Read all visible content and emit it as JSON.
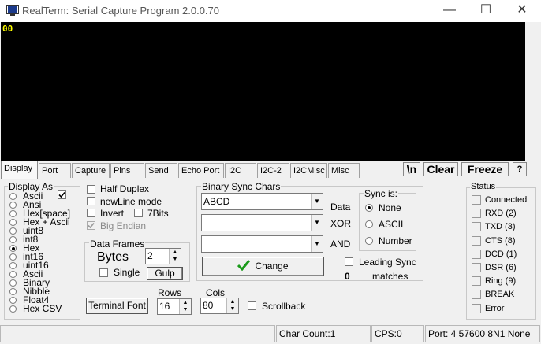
{
  "window": {
    "title": "RealTerm: Serial Capture Program 2.0.0.70",
    "minimize": "—",
    "maximize": "☐",
    "close": "✕"
  },
  "terminal": {
    "text": "00"
  },
  "tabs": [
    "Display",
    "Port",
    "Capture",
    "Pins",
    "Send",
    "Echo Port",
    "I2C",
    "I2C-2",
    "I2CMisc",
    "Misc"
  ],
  "top_buttons": {
    "newline": "\\n",
    "clear": "Clear",
    "freeze": "Freeze",
    "help": "?"
  },
  "display_as": {
    "title": "Display As",
    "options": [
      "Ascii",
      "Ansi",
      "Hex[space]",
      "Hex + Ascii",
      "uint8",
      "int8",
      "Hex",
      "int16",
      "uint16",
      "Ascii",
      "Binary",
      "Nibble",
      "Float4",
      "Hex CSV"
    ],
    "selected": "Hex"
  },
  "options": {
    "half_duplex": "Half Duplex",
    "newline_mode": "newLine mode",
    "invert": "Invert",
    "seven_bits": "7Bits",
    "big_endian": "Big Endian"
  },
  "data_frames": {
    "title": "Data Frames",
    "bytes_label": "Bytes",
    "bytes_value": "2",
    "single": "Single",
    "gulp": "Gulp"
  },
  "binary_sync": {
    "title": "Binary Sync Chars",
    "data_value": "ABCD",
    "data_label": "Data",
    "xor_label": "XOR",
    "and_label": "AND",
    "change": "Change",
    "sync_is_title": "Sync is:",
    "sync_options": [
      "None",
      "ASCII",
      "Number"
    ],
    "sync_selected": "None",
    "leading_sync": "Leading Sync",
    "matches_count": "0",
    "matches_label": "matches"
  },
  "terminal_font": "Terminal Font",
  "rows": {
    "label": "Rows",
    "value": "16"
  },
  "cols": {
    "label": "Cols",
    "value": "80"
  },
  "scrollback": "Scrollback",
  "status": {
    "title": "Status",
    "items": [
      "Connected",
      "RXD (2)",
      "TXD (3)",
      "CTS (8)",
      "DCD (1)",
      "DSR (6)",
      "Ring (9)",
      "BREAK",
      "Error"
    ]
  },
  "statusbar": {
    "char_count": "Char Count:1",
    "cps": "CPS:0",
    "port": "Port: 4 57600 8N1 None"
  },
  "colors": {
    "terminal_bg": "#000000",
    "terminal_fg": "#ffff00",
    "change_icon": "#1a9a1a"
  }
}
